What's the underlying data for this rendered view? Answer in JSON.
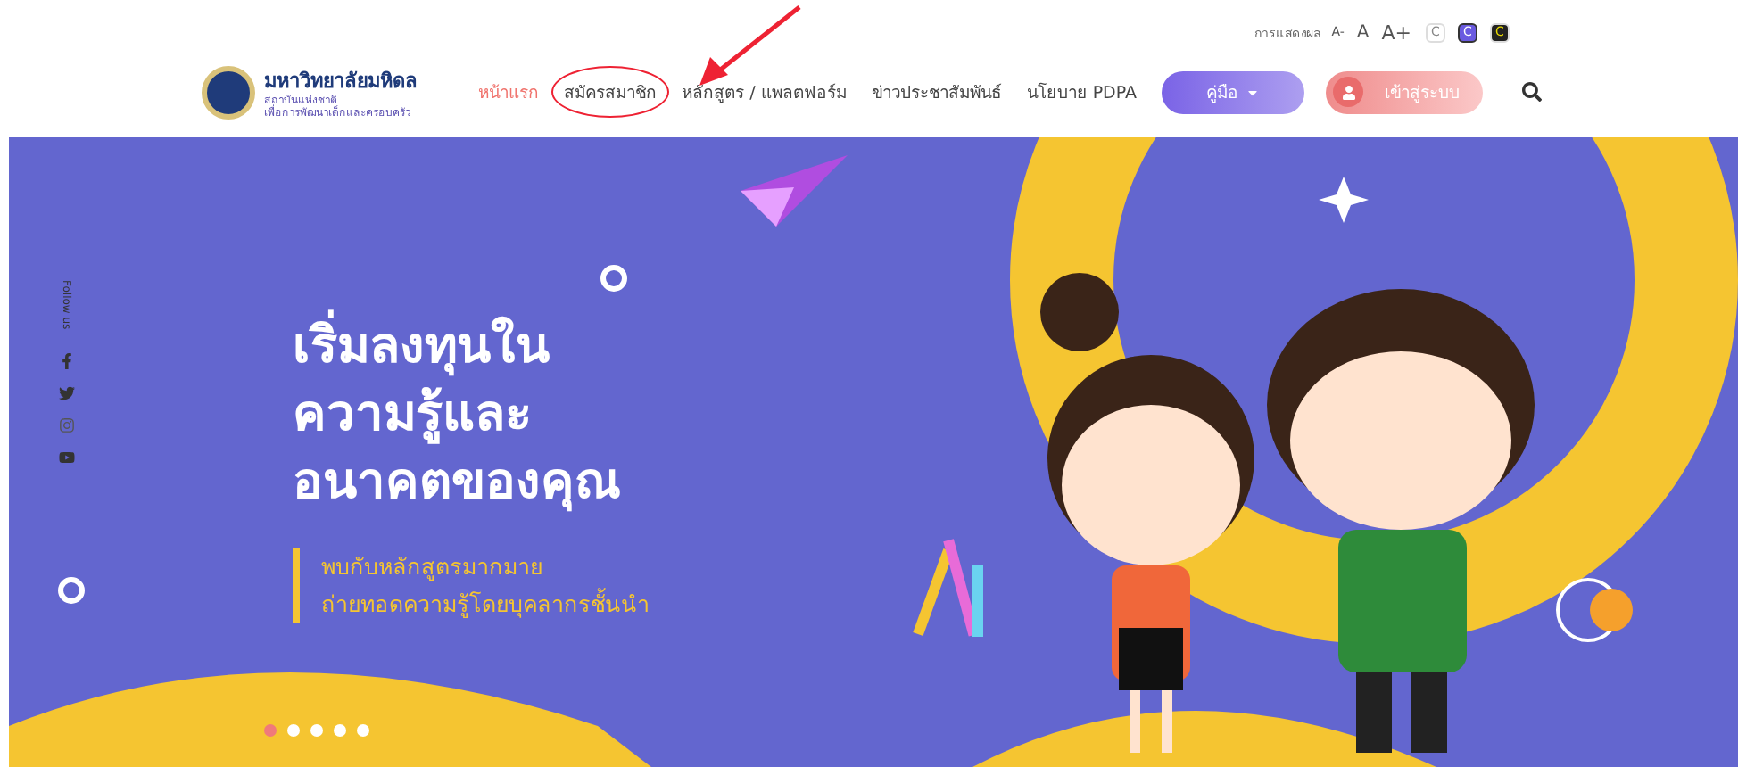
{
  "logo": {
    "title": "มหาวิทยาลัยมหิดล",
    "subtitle_lines": [
      "สถาบันแห่งชาติ",
      "เพื่อการพัฒนาเด็กและครอบครัว"
    ]
  },
  "display_controls": {
    "label": "การแสดงผล",
    "font_sizes": [
      "A-",
      "A",
      "A+"
    ],
    "contrast": [
      {
        "label": "C",
        "kind": "normal",
        "selected": false
      },
      {
        "label": "C",
        "kind": "purple",
        "selected": true
      },
      {
        "label": "C",
        "kind": "dark",
        "selected": false
      }
    ]
  },
  "nav": [
    {
      "label": "หน้าแรก",
      "selected": true
    },
    {
      "label": "สมัครสมาชิก",
      "selected": false,
      "annotated": true
    },
    {
      "label": "หลักสูตร / แพลตฟอร์ม",
      "selected": false,
      "annotated": false
    },
    {
      "label": "ข่าวประชาสัมพันธ์",
      "selected": false,
      "annotated": false
    },
    {
      "label": "นโยบาย PDPA",
      "selected": false,
      "annotated": false
    }
  ],
  "manual_button": "คู่มือ",
  "login_button": "เข้าสู่ระบบ",
  "social": {
    "label": "Follow us"
  },
  "hero": {
    "headline_lines": [
      "เริ่มลงทุนใน",
      "ความรู้และ",
      "อนาคตของคุณ"
    ],
    "sub_lines": [
      "พบกับหลักสูตรมากมาย",
      "ถ่ายทอดความรู้โดยบุคลากรชั้นนำ"
    ]
  },
  "slides": [
    {
      "selected": true
    },
    {
      "selected": false
    },
    {
      "selected": false
    },
    {
      "selected": false
    },
    {
      "selected": false
    }
  ]
}
